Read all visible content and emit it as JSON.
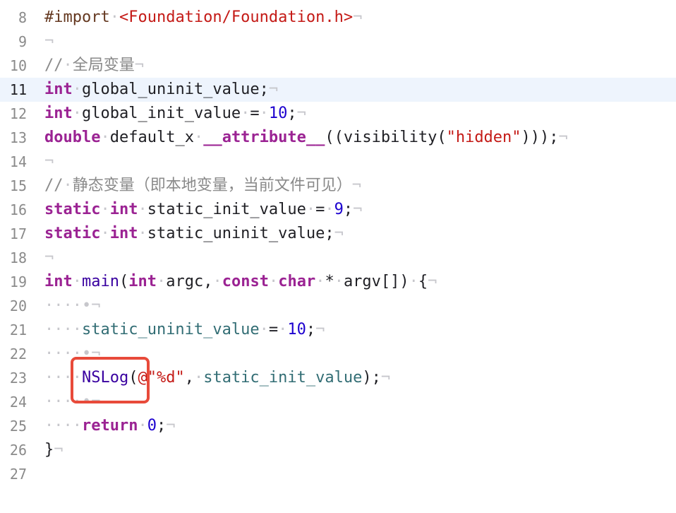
{
  "editor": {
    "highlight_color": "#e84a3a",
    "lines": [
      {
        "num": "8",
        "tokens": [
          [
            "pre",
            "#import"
          ],
          [
            "ws",
            "·"
          ],
          [
            "str",
            "<Foundation/Foundation.h>"
          ],
          [
            "ws",
            "¬"
          ]
        ]
      },
      {
        "num": "9",
        "tokens": [
          [
            "ws",
            "¬"
          ]
        ]
      },
      {
        "num": "10",
        "tokens": [
          [
            "cmt",
            "//"
          ],
          [
            "ws",
            "·"
          ],
          [
            "cmt",
            "全局变量"
          ],
          [
            "ws",
            "¬"
          ]
        ]
      },
      {
        "num": "11",
        "current": true,
        "tokens": [
          [
            "kw",
            "int"
          ],
          [
            "ws",
            "·"
          ],
          [
            "",
            "global_uninit_value;"
          ],
          [
            "ws",
            "¬"
          ]
        ]
      },
      {
        "num": "12",
        "tokens": [
          [
            "kw",
            "int"
          ],
          [
            "ws",
            "·"
          ],
          [
            "",
            "global_init_value"
          ],
          [
            "ws",
            "·"
          ],
          [
            "",
            "="
          ],
          [
            "ws",
            "·"
          ],
          [
            "num",
            "10"
          ],
          [
            "",
            ";"
          ],
          [
            "ws",
            "¬"
          ]
        ]
      },
      {
        "num": "13",
        "tokens": [
          [
            "kw",
            "double"
          ],
          [
            "ws",
            "·"
          ],
          [
            "",
            "default_x"
          ],
          [
            "ws",
            "·"
          ],
          [
            "kw",
            "__attribute__"
          ],
          [
            "",
            "((visibility("
          ],
          [
            "str",
            "\"hidden\""
          ],
          [
            "",
            ")));"
          ],
          [
            "ws",
            "¬"
          ]
        ]
      },
      {
        "num": "14",
        "tokens": [
          [
            "ws",
            "¬"
          ]
        ]
      },
      {
        "num": "15",
        "tokens": [
          [
            "cmt",
            "//"
          ],
          [
            "ws",
            "·"
          ],
          [
            "cmt",
            "静态变量（即本地变量，当前文件可见）"
          ],
          [
            "ws",
            "¬"
          ]
        ]
      },
      {
        "num": "16",
        "tokens": [
          [
            "kw",
            "static"
          ],
          [
            "ws",
            "·"
          ],
          [
            "kw",
            "int"
          ],
          [
            "ws",
            "·"
          ],
          [
            "",
            "static_init_value"
          ],
          [
            "ws",
            "·"
          ],
          [
            "",
            "="
          ],
          [
            "ws",
            "·"
          ],
          [
            "num",
            "9"
          ],
          [
            "",
            ";"
          ],
          [
            "ws",
            "¬"
          ]
        ]
      },
      {
        "num": "17",
        "tokens": [
          [
            "kw",
            "static"
          ],
          [
            "ws",
            "·"
          ],
          [
            "kw",
            "int"
          ],
          [
            "ws",
            "·"
          ],
          [
            "",
            "static_uninit_value;"
          ],
          [
            "ws",
            "¬"
          ]
        ]
      },
      {
        "num": "18",
        "tokens": [
          [
            "ws",
            "¬"
          ]
        ]
      },
      {
        "num": "19",
        "tokens": [
          [
            "kw",
            "int"
          ],
          [
            "ws",
            "·"
          ],
          [
            "fnd",
            "main"
          ],
          [
            "",
            "("
          ],
          [
            "kw",
            "int"
          ],
          [
            "ws",
            "·"
          ],
          [
            "",
            "argc,"
          ],
          [
            "ws",
            "·"
          ],
          [
            "kw",
            "const"
          ],
          [
            "ws",
            "·"
          ],
          [
            "kw",
            "char"
          ],
          [
            "ws",
            "·"
          ],
          [
            "",
            "*"
          ],
          [
            "ws",
            "·"
          ],
          [
            "",
            "argv[])"
          ],
          [
            "ws",
            "·"
          ],
          [
            "",
            "{"
          ],
          [
            "ws",
            "¬"
          ]
        ]
      },
      {
        "num": "20",
        "tokens": [
          [
            "ws",
            "····•¬"
          ]
        ]
      },
      {
        "num": "21",
        "tokens": [
          [
            "ws",
            "····"
          ],
          [
            "fn",
            "static_uninit_value"
          ],
          [
            "ws",
            "·"
          ],
          [
            "",
            "="
          ],
          [
            "ws",
            "·"
          ],
          [
            "num",
            "10"
          ],
          [
            "",
            ";"
          ],
          [
            "ws",
            "¬"
          ]
        ]
      },
      {
        "num": "22",
        "tokens": [
          [
            "ws",
            "····•¬"
          ]
        ]
      },
      {
        "num": "23",
        "tokens": [
          [
            "ws",
            "····"
          ],
          [
            "fnd",
            "NSLog"
          ],
          [
            "",
            "("
          ],
          [
            "str",
            "@\"%d\""
          ],
          [
            "",
            ","
          ],
          [
            "ws",
            "·"
          ],
          [
            "fn",
            "static_init_value"
          ],
          [
            "",
            ");"
          ],
          [
            "ws",
            "¬"
          ]
        ]
      },
      {
        "num": "24",
        "tokens": [
          [
            "ws",
            "····•¬"
          ]
        ]
      },
      {
        "num": "25",
        "tokens": [
          [
            "ws",
            "····"
          ],
          [
            "kw",
            "return"
          ],
          [
            "ws",
            "·"
          ],
          [
            "num",
            "0"
          ],
          [
            "",
            ";"
          ],
          [
            "ws",
            "¬"
          ]
        ]
      },
      {
        "num": "26",
        "tokens": [
          [
            "",
            "}"
          ],
          [
            "ws",
            "¬"
          ]
        ]
      },
      {
        "num": "27",
        "tokens": []
      }
    ]
  }
}
